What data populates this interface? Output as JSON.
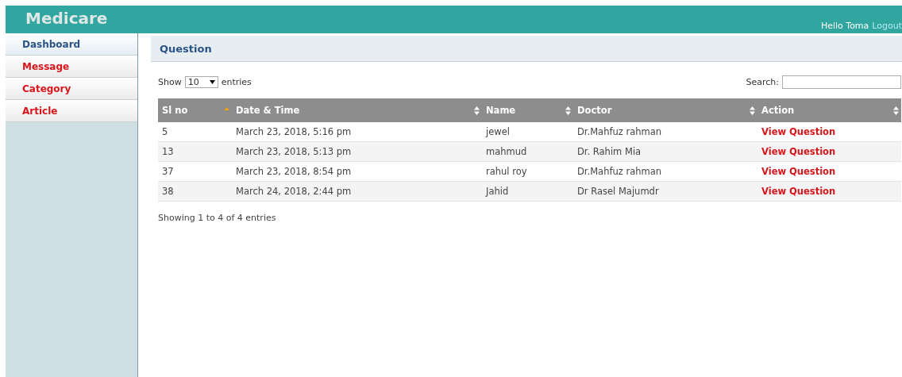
{
  "header": {
    "brand": "Medicare",
    "greeting": "Hello Toma",
    "logout": "Logout"
  },
  "sidebar": {
    "items": [
      {
        "label": "Dashboard",
        "selected": true
      },
      {
        "label": "Message",
        "selected": false
      },
      {
        "label": "Category",
        "selected": false
      },
      {
        "label": "Article",
        "selected": false
      }
    ]
  },
  "panel": {
    "title": "Question"
  },
  "length_menu": {
    "before": "Show",
    "value": "10",
    "after": "entries"
  },
  "search": {
    "label": "Search:"
  },
  "table": {
    "columns": [
      {
        "label": "Sl no",
        "sorted": true
      },
      {
        "label": "Date & Time",
        "sorted": false
      },
      {
        "label": "Name",
        "sorted": false
      },
      {
        "label": "Doctor",
        "sorted": false
      },
      {
        "label": "Action",
        "sorted": false
      }
    ],
    "rows": [
      {
        "sl_no": "5",
        "date_time": "March 23, 2018, 5:16 pm",
        "name": "jewel",
        "doctor": "Dr.Mahfuz rahman",
        "action": "View Question"
      },
      {
        "sl_no": "13",
        "date_time": "March 23, 2018, 5:13 pm",
        "name": "mahmud",
        "doctor": "Dr. Rahim Mia",
        "action": "View Question"
      },
      {
        "sl_no": "37",
        "date_time": "March 23, 2018, 8:54 pm",
        "name": "rahul roy",
        "doctor": "Dr.Mahfuz rahman",
        "action": "View Question"
      },
      {
        "sl_no": "38",
        "date_time": "March 24, 2018, 2:44 pm",
        "name": "Jahid",
        "doctor": "Dr Rasel Majumdr",
        "action": "View Question"
      }
    ]
  },
  "info": "Showing 1 to 4 of 4 entries"
}
